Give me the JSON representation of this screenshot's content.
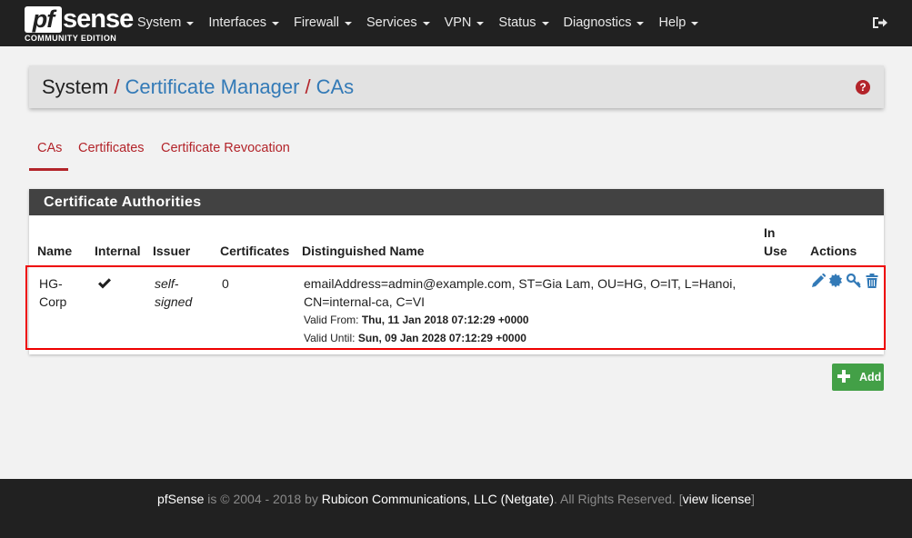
{
  "brand": {
    "logo_pf": "pf",
    "logo_sense": "sense",
    "edition": "COMMUNITY EDITION"
  },
  "nav": {
    "items": [
      {
        "label": "System"
      },
      {
        "label": "Interfaces"
      },
      {
        "label": "Firewall"
      },
      {
        "label": "Services"
      },
      {
        "label": "VPN"
      },
      {
        "label": "Status"
      },
      {
        "label": "Diagnostics"
      },
      {
        "label": "Help"
      }
    ],
    "logout_icon": "sign-out-icon"
  },
  "breadcrumb": {
    "root": "System",
    "sep": "/",
    "level2": "Certificate Manager",
    "level3": "CAs",
    "help_icon": "question-circle-icon",
    "help_glyph": "?"
  },
  "tabs": [
    {
      "label": "CAs",
      "active": true
    },
    {
      "label": "Certificates",
      "active": false
    },
    {
      "label": "Certificate Revocation",
      "active": false
    }
  ],
  "panel": {
    "title": "Certificate Authorities",
    "columns": [
      "Name",
      "Internal",
      "Issuer",
      "Certificates",
      "Distinguished Name",
      "In",
      "Use",
      "Actions"
    ],
    "row": {
      "name_line1": "HG-",
      "name_line2": "Corp",
      "internal_icon": "check-icon",
      "issuer_line1": "self-",
      "issuer_line2": "signed",
      "certificates": "0",
      "dn_line1": "emailAddress=admin@example.com, ST=Gia Lam, OU=HG, O=IT, L=Hanoi,",
      "dn_line2": "CN=internal-ca, C=VI",
      "valid_from_label": "Valid From:",
      "valid_from": "Thu, 11 Jan 2018 07:12:29 +0000",
      "valid_until_label": "Valid Until:",
      "valid_until": "Sun, 09 Jan 2028 07:12:29 +0000",
      "actions": [
        "pencil-icon",
        "certificate-icon",
        "key-icon",
        "trash-icon"
      ]
    }
  },
  "add_button": {
    "label": "Add",
    "icon": "plus-icon"
  },
  "footer": {
    "brand": "pfSense",
    "text1": " is © 2004 - 2018 by ",
    "company": "Rubicon Communications, LLC (Netgate)",
    "text2": ". All Rights Reserved. [",
    "license": "view license",
    "text3": "]"
  },
  "colors": {
    "navbar": "#212121",
    "accent_red": "#b3242a",
    "link_blue": "#337ab7",
    "panel_head": "#424242",
    "add_green": "#43a047"
  }
}
